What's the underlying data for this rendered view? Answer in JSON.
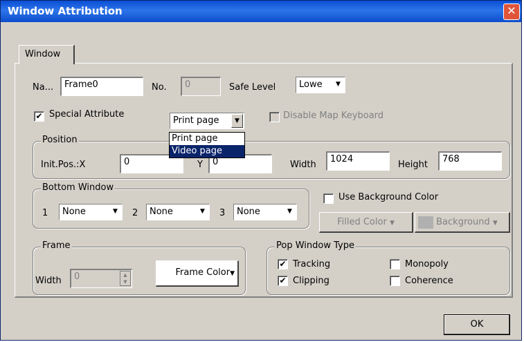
{
  "window": {
    "title": "Window Attribution",
    "close_glyph": "✕"
  },
  "tabs": [
    {
      "label": "Window"
    }
  ],
  "name": {
    "label": "Na...",
    "value": "Frame0"
  },
  "no": {
    "label": "No.",
    "value": "0"
  },
  "safe_level": {
    "label": "Safe Level",
    "value": "Lowe"
  },
  "special_attribute": {
    "label": "Special Attribute",
    "checked": true
  },
  "page_type": {
    "value": "Print page",
    "options": [
      "Print page",
      "Video page"
    ],
    "highlighted": "Video page"
  },
  "disable_map_keyboard": {
    "label": "Disable Map Keyboard",
    "checked": false,
    "enabled": false
  },
  "position": {
    "title": "Position",
    "init_pos_x_label": "Init.Pos.:X",
    "x_value": "0",
    "y_label": "Y",
    "y_value": "0",
    "width_label": "Width",
    "width_value": "1024",
    "height_label": "Height",
    "height_value": "768"
  },
  "bottom_window": {
    "title": "Bottom Window",
    "slots": [
      {
        "num": "1",
        "value": "None"
      },
      {
        "num": "2",
        "value": "None"
      },
      {
        "num": "3",
        "value": "None"
      }
    ]
  },
  "use_background_color": {
    "label": "Use Background Color",
    "checked": false
  },
  "filled_color": {
    "label": "Filled Color"
  },
  "background": {
    "label": "Background"
  },
  "frame": {
    "title": "Frame",
    "width_label": "Width",
    "width_value": "0",
    "color_label": "Frame Color"
  },
  "pop_window_type": {
    "title": "Pop Window Type",
    "tracking": {
      "label": "Tracking",
      "checked": true
    },
    "clipping": {
      "label": "Clipping",
      "checked": true
    },
    "monopoly": {
      "label": "Monopoly",
      "checked": false
    },
    "coherence": {
      "label": "Coherence",
      "checked": false
    }
  },
  "ok_button": {
    "label": "OK"
  },
  "glyphs": {
    "check": "✔",
    "down": "▼",
    "up": "▲"
  }
}
